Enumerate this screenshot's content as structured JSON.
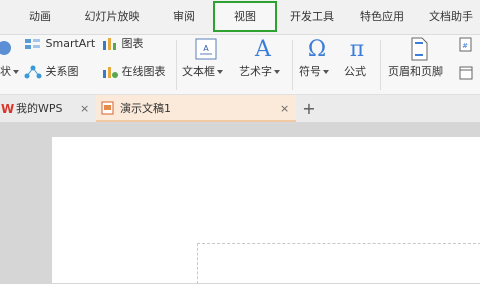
{
  "menu": {
    "tabs": [
      "动画",
      "幻灯片放映",
      "审阅",
      "视图",
      "开发工具",
      "特色应用",
      "文档助手"
    ],
    "active_tab": "视图",
    "active_color": "#2ea22e"
  },
  "ribbon": {
    "shape_partial_label": "状",
    "smartart_label": "SmartArt",
    "chart_label": "图表",
    "relation_label": "关系图",
    "online_chart_label": "在线图表",
    "textbox_label": "文本框",
    "wordart_label": "艺术字",
    "symbol_label": "符号",
    "formula_label": "公式",
    "header_footer_label": "页眉和页脚",
    "icons": [
      "shape-icon",
      "smartart-icon",
      "chart-icon",
      "relation-icon",
      "online-chart-icon",
      "textbox-icon",
      "wordart-icon",
      "symbol-icon",
      "formula-icon",
      "header-footer-icon"
    ]
  },
  "tabs": {
    "home_label": "我的WPS",
    "doc_label": "演示文稿1",
    "add_symbol": "+",
    "close_symbol": "×"
  }
}
